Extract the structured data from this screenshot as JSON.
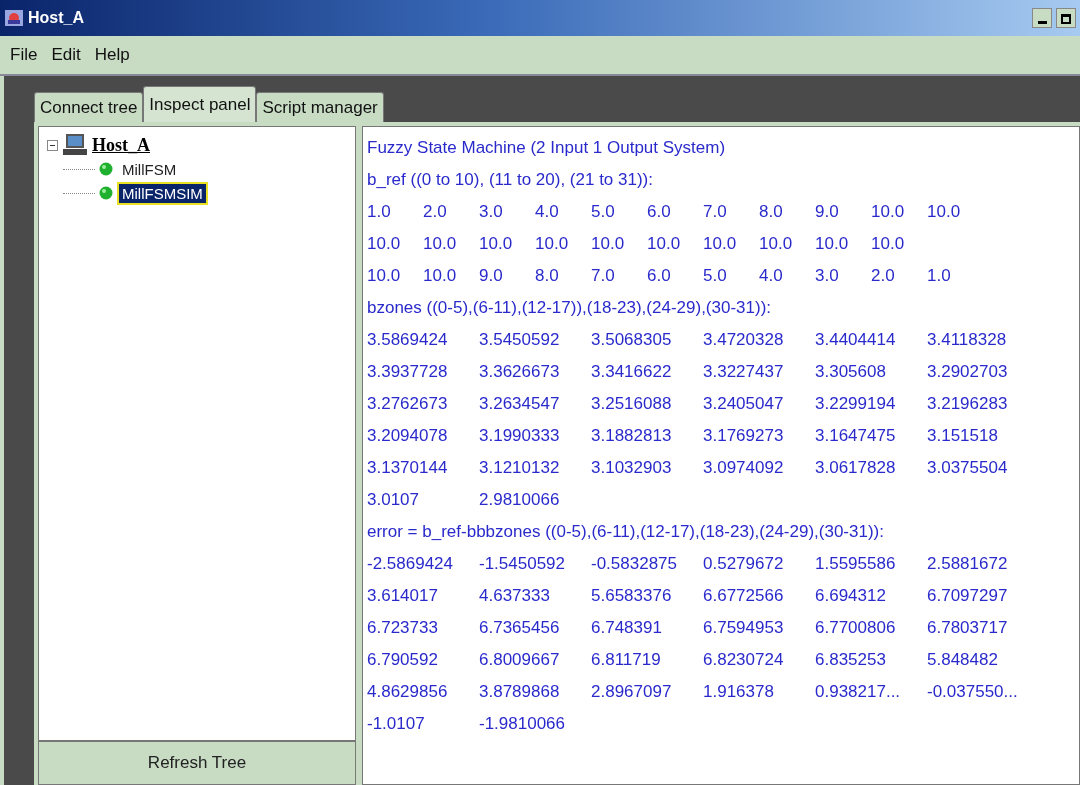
{
  "window": {
    "title": "Host_A"
  },
  "menu": [
    "File",
    "Edit",
    "Help"
  ],
  "tabs": [
    {
      "label": "Connect tree",
      "selected": false
    },
    {
      "label": "Inspect panel",
      "selected": true
    },
    {
      "label": "Script manager",
      "selected": false
    }
  ],
  "tree": {
    "label": "Host_A",
    "expanded": true,
    "children": [
      {
        "label": "MillFSM",
        "selected": false
      },
      {
        "label": "MillFSMSIM",
        "selected": true
      }
    ]
  },
  "refresh_button": "Refresh Tree",
  "output": [
    {
      "kind": "text",
      "text": "Fuzzy State Machine (2 Input 1 Output System)"
    },
    {
      "kind": "text",
      "text": "b_ref ((0 to 10), (11 to 20), (21 to 31)):"
    },
    {
      "kind": "short",
      "cells": [
        "1.0",
        "2.0",
        "3.0",
        "4.0",
        "5.0",
        "6.0",
        "7.0",
        "8.0",
        "9.0",
        "10.0",
        "10.0"
      ]
    },
    {
      "kind": "short",
      "cells": [
        "10.0",
        "10.0",
        "10.0",
        "10.0",
        "10.0",
        "10.0",
        "10.0",
        "10.0",
        "10.0",
        "10.0"
      ]
    },
    {
      "kind": "short",
      "cells": [
        "10.0",
        "10.0",
        "9.0",
        "8.0",
        "7.0",
        "6.0",
        "5.0",
        "4.0",
        "3.0",
        "2.0",
        "1.0"
      ]
    },
    {
      "kind": "text",
      "text": "bzones ((0-5),(6-11),(12-17)),(18-23),(24-29),(30-31)):"
    },
    {
      "kind": "long",
      "cells": [
        "3.5869424",
        "3.5450592",
        "3.5068305",
        "3.4720328",
        "3.4404414",
        "3.4118328"
      ]
    },
    {
      "kind": "long",
      "cells": [
        "3.3937728",
        "3.3626673",
        "3.3416622",
        "3.3227437",
        "3.305608",
        "3.2902703"
      ]
    },
    {
      "kind": "long",
      "cells": [
        "3.2762673",
        "3.2634547",
        "3.2516088",
        "3.2405047",
        "3.2299194",
        "3.2196283"
      ]
    },
    {
      "kind": "long",
      "cells": [
        "3.2094078",
        "3.1990333",
        "3.1882813",
        "3.1769273",
        "3.1647475",
        "3.151518"
      ]
    },
    {
      "kind": "long",
      "cells": [
        "3.1370144",
        "3.1210132",
        "3.1032903",
        "3.0974092",
        "3.0617828",
        "3.0375504"
      ]
    },
    {
      "kind": "long",
      "cells": [
        "3.0107",
        "2.9810066"
      ]
    },
    {
      "kind": "text",
      "text": "error = b_ref-bbbzones ((0-5),(6-11),(12-17),(18-23),(24-29),(30-31)):"
    },
    {
      "kind": "long",
      "cells": [
        "-2.5869424",
        "-1.5450592",
        "-0.5832875",
        "0.5279672",
        "1.5595586",
        "2.5881672"
      ]
    },
    {
      "kind": "long",
      "cells": [
        "3.614017",
        "4.637333",
        "5.6583376",
        "6.6772566",
        "6.694312",
        "6.7097297"
      ]
    },
    {
      "kind": "long",
      "cells": [
        "6.723733",
        "6.7365456",
        "6.748391",
        "6.7594953",
        "6.7700806",
        "6.7803717"
      ]
    },
    {
      "kind": "long",
      "cells": [
        "6.790592",
        "6.8009667",
        "6.811719",
        "6.8230724",
        "6.835253",
        "5.848482"
      ]
    },
    {
      "kind": "long",
      "cells": [
        "4.8629856",
        "3.8789868",
        "2.8967097",
        "1.916378",
        "0.938217...",
        "-0.037550..."
      ]
    },
    {
      "kind": "long",
      "cells": [
        "-1.0107",
        "-1.9810066"
      ]
    }
  ]
}
